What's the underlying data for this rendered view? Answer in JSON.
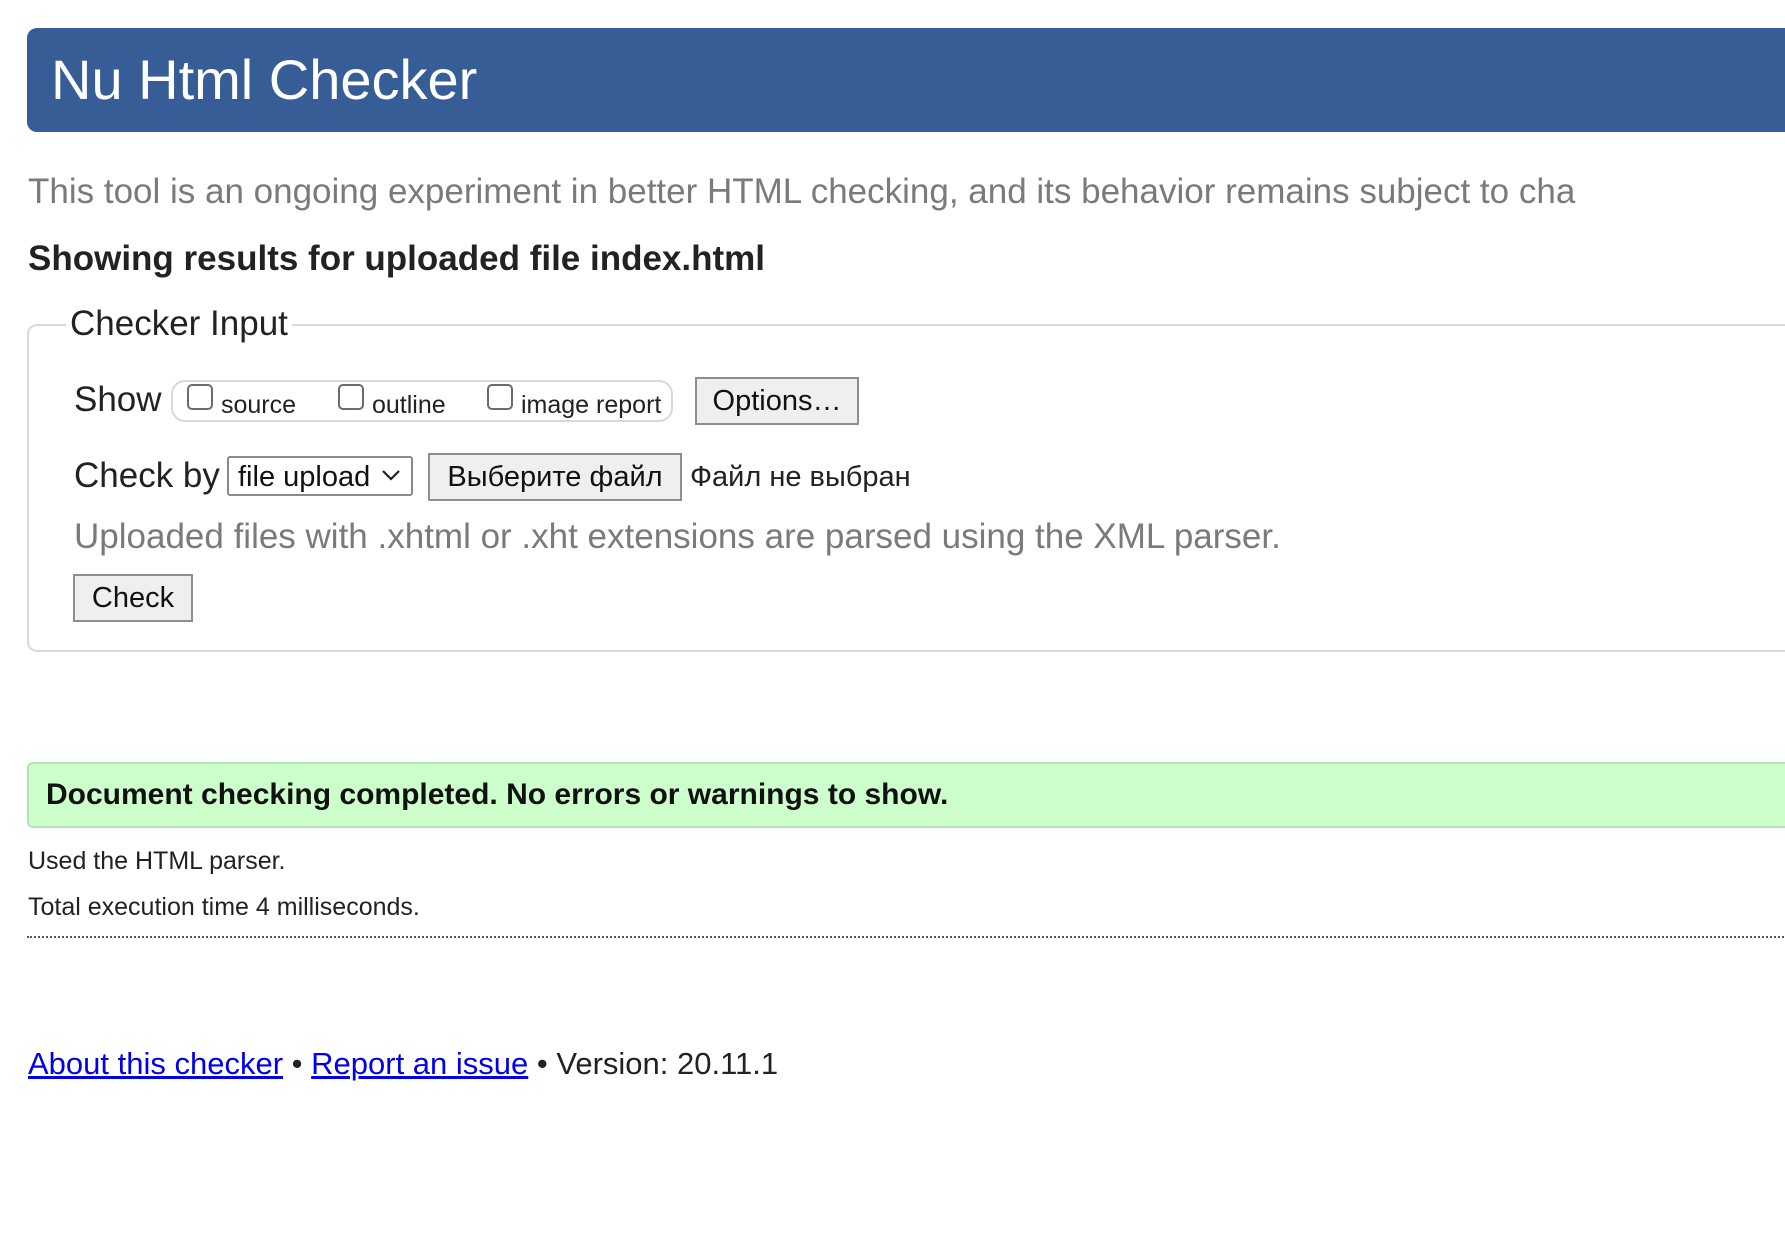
{
  "header": {
    "title": "Nu Html Checker"
  },
  "intro": {
    "text": "This tool is an ongoing experiment in better HTML checking, and its behavior remains subject to cha"
  },
  "results": {
    "heading": "Showing results for uploaded file index.html"
  },
  "checker_input": {
    "legend": "Checker Input",
    "show_label": "Show",
    "show_options": [
      {
        "label": "source",
        "checked": false
      },
      {
        "label": "outline",
        "checked": false
      },
      {
        "label": "image report",
        "checked": false
      }
    ],
    "options_button": "Options…",
    "check_by_label": "Check by",
    "check_by_value": "file upload",
    "choose_file_button": "Выберите файл",
    "file_status": "Файл не выбран",
    "parser_note": "Uploaded files with .xhtml or .xht extensions are parsed using the XML parser.",
    "check_button": "Check"
  },
  "outcome": {
    "message": "Document checking completed. No errors or warnings to show.",
    "parser_used": "Used the HTML parser.",
    "execution_time": "Total execution time 4 milliseconds."
  },
  "footer": {
    "about_link": "About this checker",
    "separator": "•",
    "report_link": "Report an issue",
    "version": "Version: 20.11.1"
  },
  "colors": {
    "header_bg": "#365d95",
    "success_bg": "#ccffcc",
    "link": "#0000ee",
    "muted_text": "#7a7a7a"
  }
}
